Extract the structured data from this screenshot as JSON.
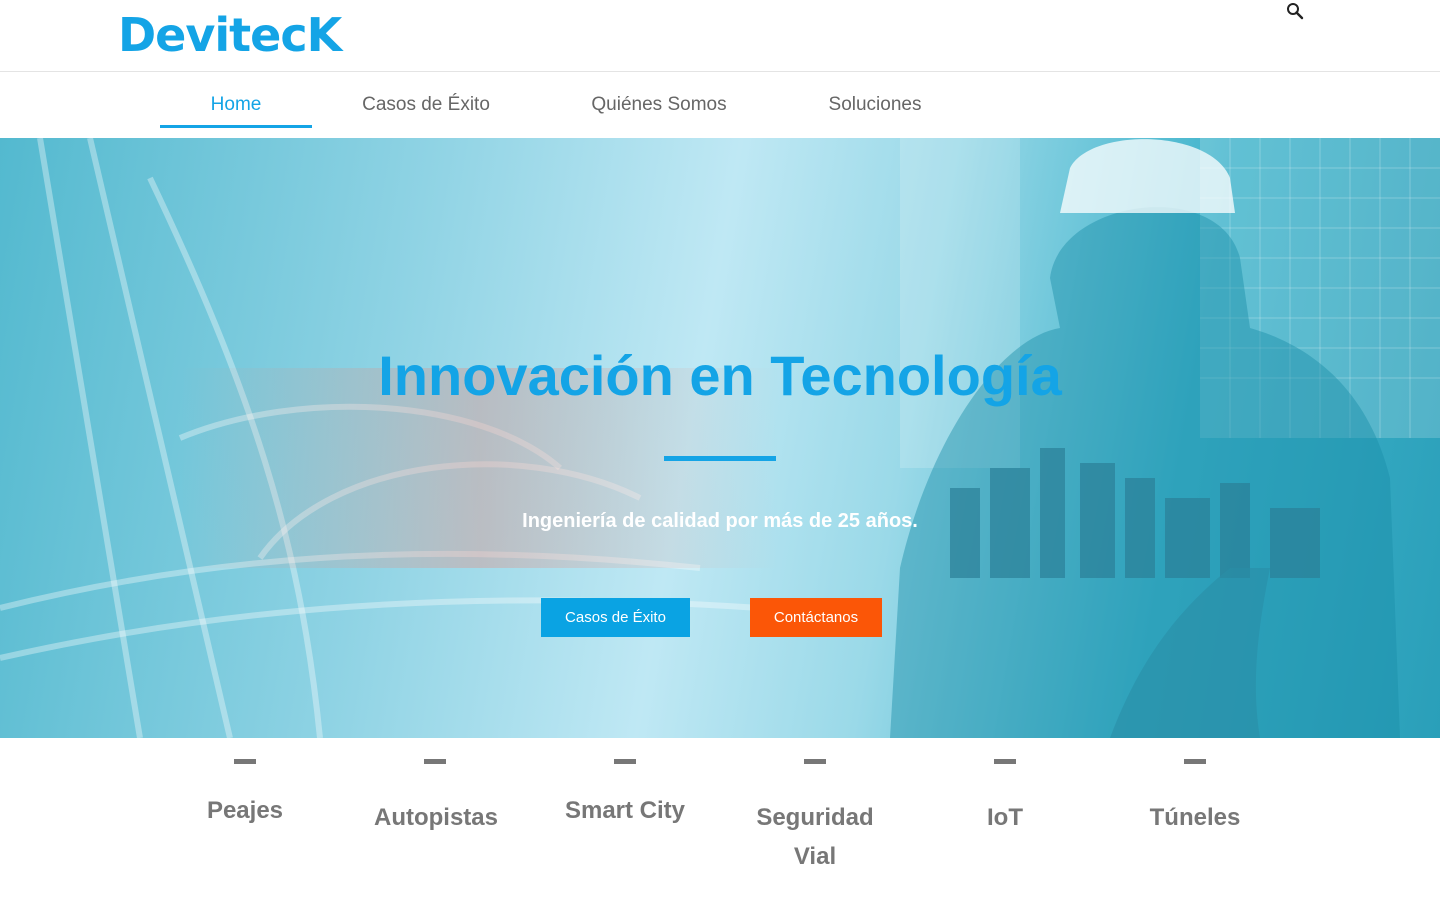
{
  "header": {
    "logo_text": "DevitecK",
    "search_icon": "search-icon"
  },
  "nav": {
    "items": [
      {
        "label": "Home",
        "active": true
      },
      {
        "label": "Casos de Éxito",
        "active": false
      },
      {
        "label": "Quiénes Somos",
        "active": false
      },
      {
        "label": "Soluciones",
        "active": false
      }
    ]
  },
  "hero": {
    "title": "Innovación en Tecnología",
    "subtitle": "Ingeniería de calidad por más de 25 años.",
    "primary_button": "Casos de Éxito",
    "secondary_button": "Contáctanos"
  },
  "features": {
    "items": [
      {
        "label": "Peajes"
      },
      {
        "label": "Autopistas"
      },
      {
        "label": "Smart City"
      },
      {
        "label": "Seguridad Vial"
      },
      {
        "label": "IoT"
      },
      {
        "label": "Túneles"
      }
    ]
  },
  "colors": {
    "accent": "#14a4e6",
    "orange": "#fb5607",
    "muted_text": "#777777"
  }
}
